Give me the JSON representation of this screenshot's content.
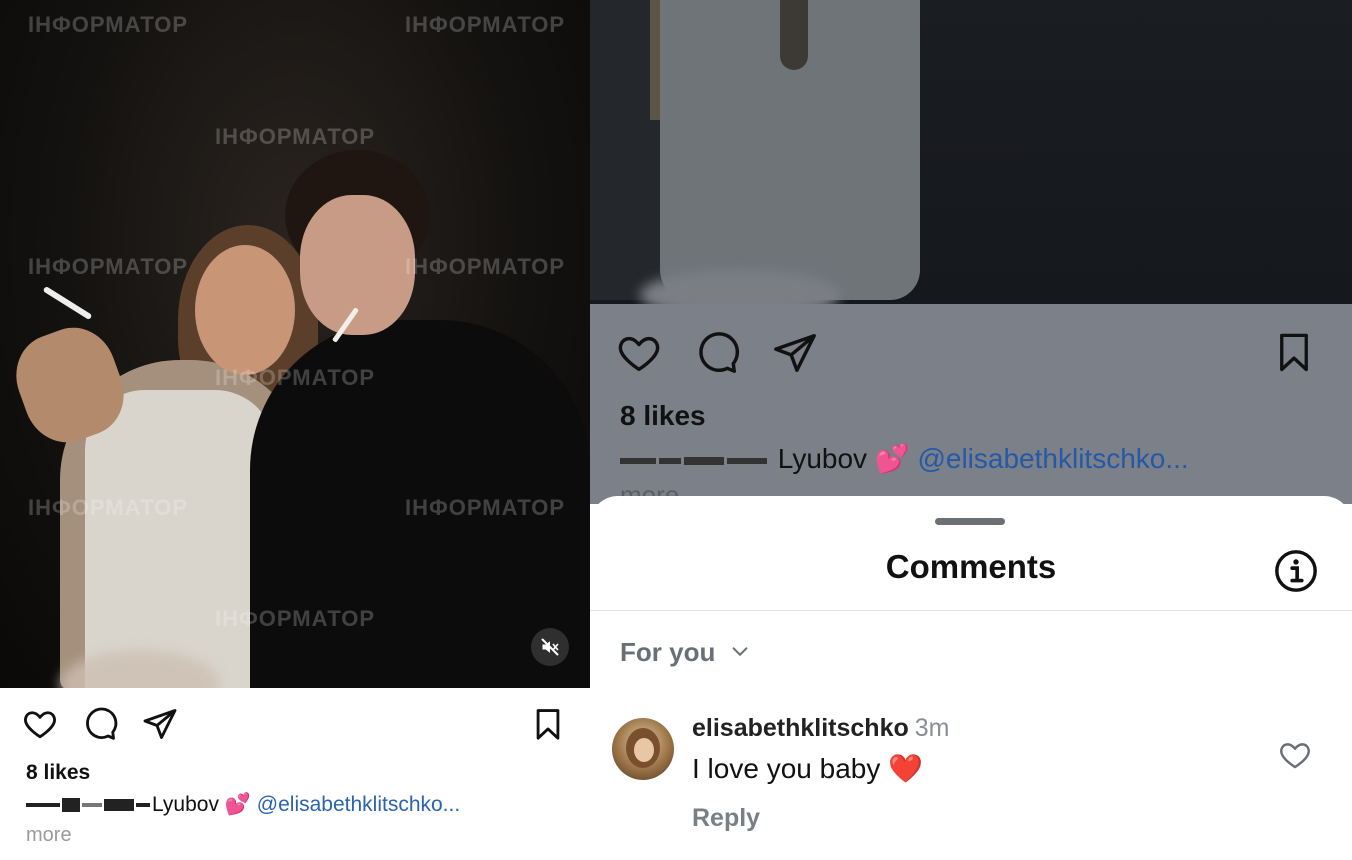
{
  "watermark": "ІНФОРМАТОР",
  "left_post": {
    "likes": "8 likes",
    "caption_name": "Lyubov",
    "caption_emoji": "💕",
    "caption_mention": "@elisabethklitschko...",
    "more": "more",
    "mute_icon": "speaker-muted-icon"
  },
  "right_post": {
    "likes": "8 likes",
    "caption_name": "Lyubov",
    "caption_emoji": "💕",
    "caption_mention": "@elisabethklitschko...",
    "more": "more"
  },
  "comments_sheet": {
    "title": "Comments",
    "sort_label": "For you",
    "comment": {
      "username": "elisabethklitschko",
      "time": "3m",
      "text": "I love you baby",
      "emoji": "❤️",
      "reply_label": "Reply"
    }
  },
  "colors": {
    "mention": "#2b63b0",
    "overlay": "#7b8089",
    "sheet_bg": "#ffffff"
  }
}
